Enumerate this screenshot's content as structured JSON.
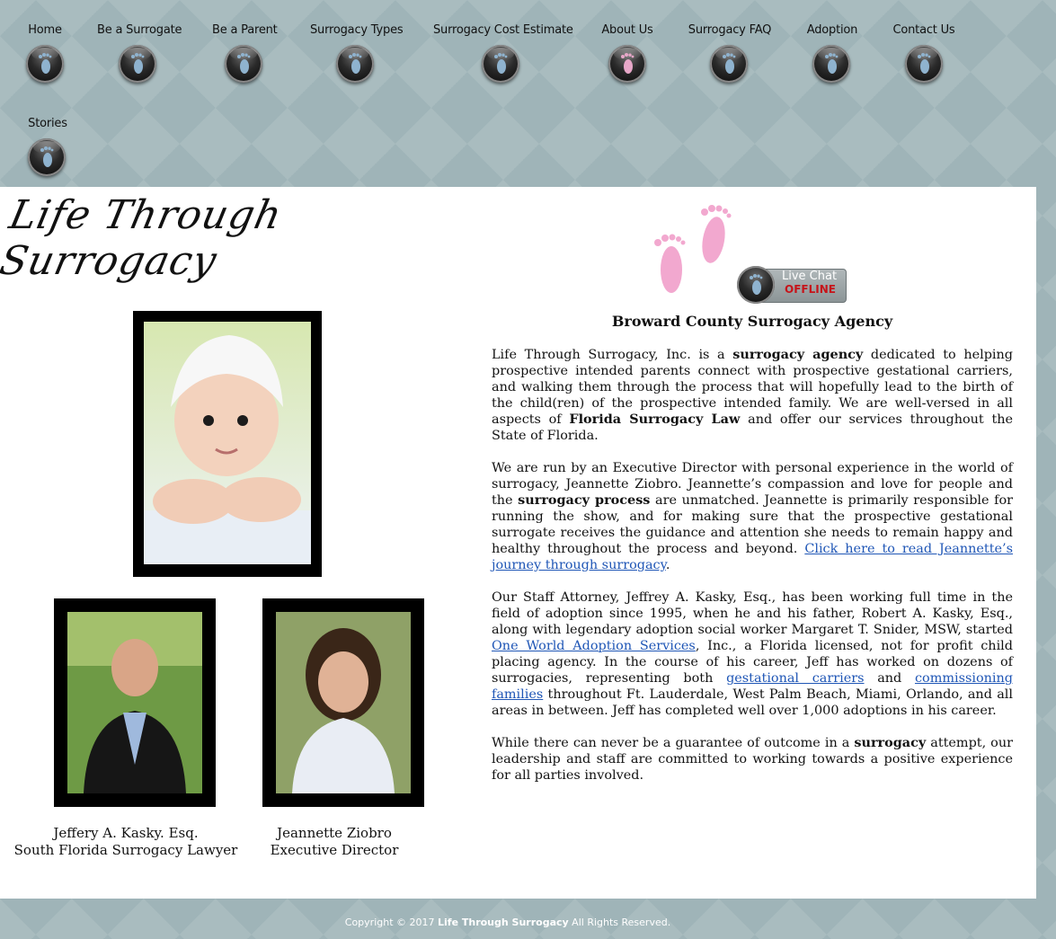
{
  "nav": {
    "items": [
      {
        "label": "Home"
      },
      {
        "label": "Be a Surrogate"
      },
      {
        "label": "Be a Parent"
      },
      {
        "label": "Surrogacy Types"
      },
      {
        "label": "Surrogacy Cost Estimate"
      },
      {
        "label": "About Us",
        "active": true
      },
      {
        "label": "Surrogacy FAQ"
      },
      {
        "label": "Adoption"
      },
      {
        "label": "Contact Us"
      },
      {
        "label": "Stories"
      }
    ],
    "colors": {
      "foot_default": "#8fb3cf",
      "foot_active": "#e7a7c8"
    }
  },
  "logo": {
    "text": "Life Through Surrogacy"
  },
  "chat": {
    "title": "Live Chat",
    "status": "OFFLINE"
  },
  "agency_title": "Broward County Surrogacy Agency",
  "content": {
    "p1": {
      "t1": "Life Through Surrogacy, Inc. is a ",
      "b1": "surrogacy agency",
      "t2": " dedicated to helping prospective intended parents connect with prospective gestational carriers, and walking them through the process that will hopefully lead to the birth of the child(ren) of the prospective intended family. We are well-versed in all aspects of ",
      "b2": "Florida Surrogacy Law",
      "t3": " and offer our services throughout the State of Florida."
    },
    "p2": {
      "t1": "We are run by an Executive Director with personal experience in the world of surrogacy, Jeannette Ziobro. Jeannette’s compassion and love for people and the ",
      "b1": "surrogacy process",
      "t2": " are unmatched. Jeannette is primarily responsible for running the show, and for making sure that the prospective gestational surrogate receives the guidance and attention she needs to remain happy and healthy throughout the process and beyond. ",
      "link": "Click here to read Jeannette’s journey through surrogacy",
      "t3": "."
    },
    "p3": {
      "t1": "Our Staff Attorney, Jeffrey A. Kasky, Esq., has been working full time in the field of adoption since 1995, when he and his father, Robert A. Kasky, Esq., along with legendary adoption social worker Margaret T. Snider, MSW, started ",
      "link1": "One World Adoption Services",
      "t2": ", Inc., a Florida licensed, not for profit child placing agency. In the course of his career, Jeff has worked on dozens of surrogacies, representing both ",
      "link2": "gestational carriers",
      "t3": " and ",
      "link3": "commissioning families",
      "t4": " throughout Ft. Lauderdale, West Palm Beach, Miami, Orlando, and all areas in between. Jeff has completed well over 1,000 adoptions in his career."
    },
    "p4": {
      "t1": "While there can never be a guarantee of outcome in a ",
      "b1": "surrogacy",
      "t2": " attempt, our leadership and staff are committed to working towards a positive experience for all parties involved."
    }
  },
  "staff": [
    {
      "name": "Jeffery A. Kasky. Esq.",
      "title": "South Florida Surrogacy Lawyer"
    },
    {
      "name": "Jeannette Ziobro",
      "title": "Executive Director"
    }
  ],
  "footer": {
    "prefix": "Copyright © 2017 ",
    "brand": "Life Through Surrogacy",
    "suffix": " All Rights Reserved."
  }
}
